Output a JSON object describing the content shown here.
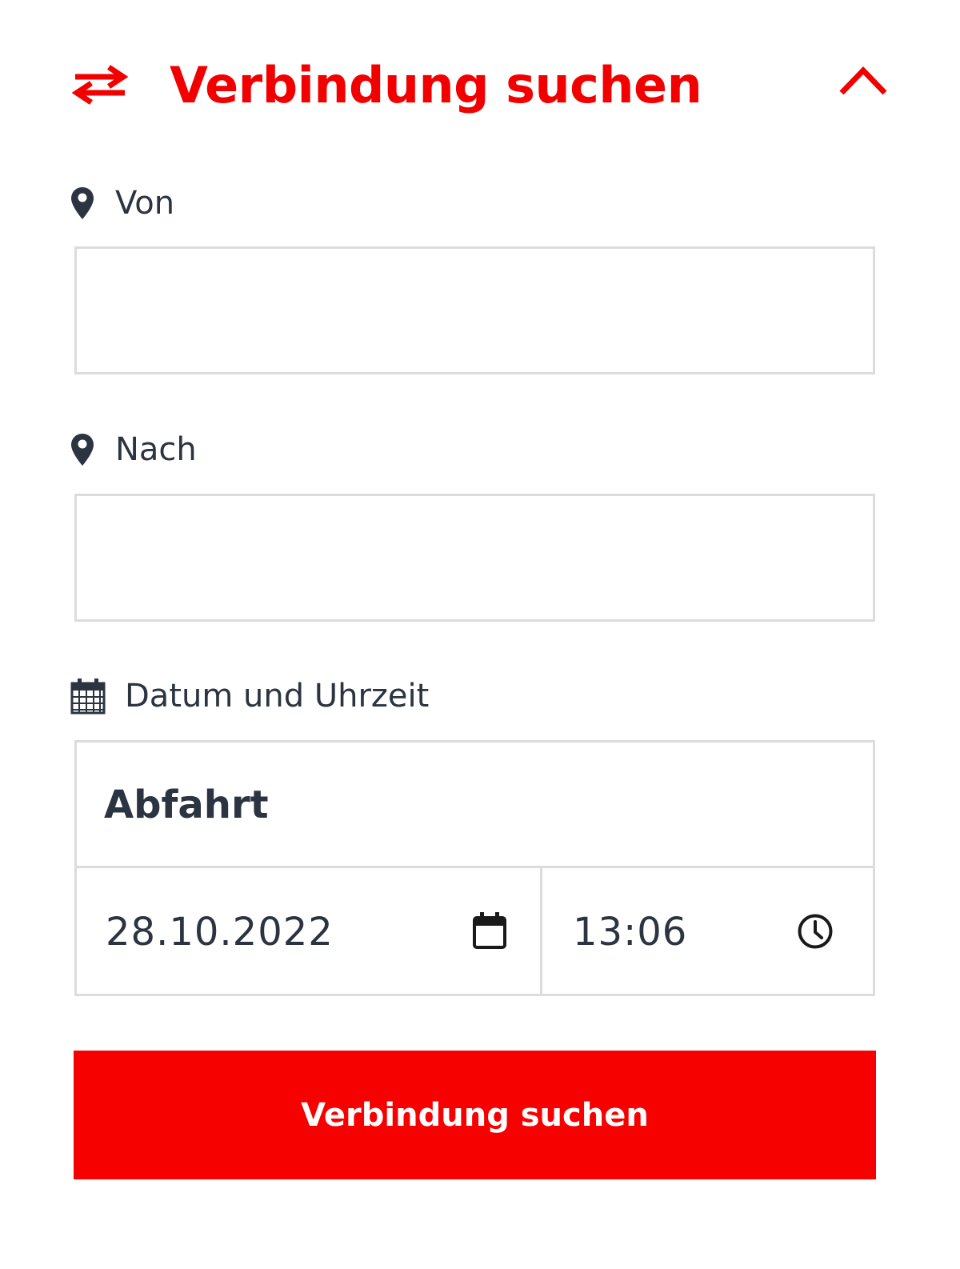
{
  "header": {
    "title": "Verbindung suchen",
    "swap_icon": "swap-arrows-icon",
    "collapse_icon": "chevron-up-icon",
    "accent_color": "#f20000"
  },
  "from": {
    "label": "Von",
    "icon": "map-pin-icon",
    "value": ""
  },
  "to": {
    "label": "Nach",
    "icon": "map-pin-icon",
    "value": ""
  },
  "datetime": {
    "label": "Datum und Uhrzeit",
    "icon": "calendar-icon",
    "mode": "Abfahrt",
    "date": "28.10.2022",
    "date_icon": "calendar-picker-icon",
    "time": "13:06",
    "time_icon": "clock-icon"
  },
  "submit": {
    "label": "Verbindung suchen",
    "color": "#f70000"
  }
}
